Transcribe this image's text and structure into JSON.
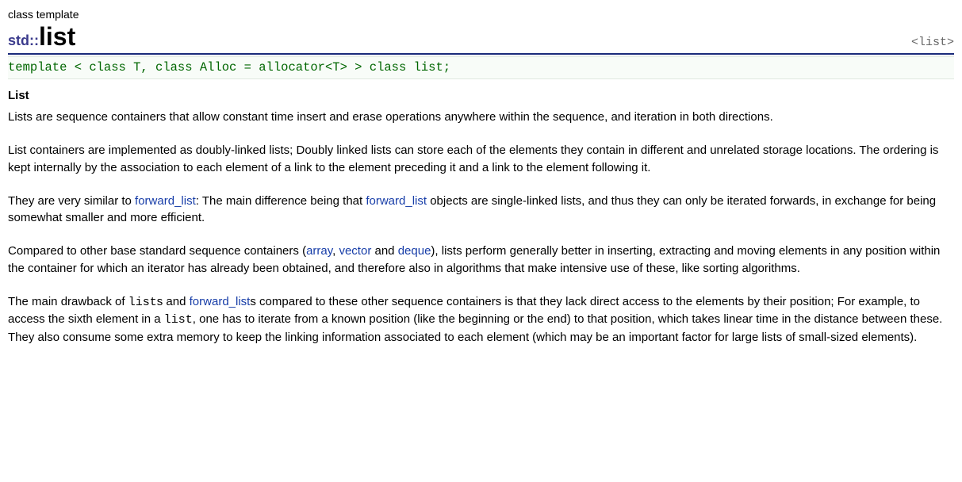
{
  "category": "class template",
  "namespace": "std::",
  "class_name": "list",
  "header_include": "<list>",
  "template_decl": "template < class T, class Alloc = allocator<T> > class list;",
  "section_title": "List",
  "paragraphs": {
    "p1": "Lists are sequence containers that allow constant time insert and erase operations anywhere within the sequence, and iteration in both directions.",
    "p2": "List containers are implemented as doubly-linked lists; Doubly linked lists can store each of the elements they contain in different and unrelated storage locations. The ordering is kept internally by the association to each element of a link to the element preceding it and a link to the element following it.",
    "p3a": "They are very similar to ",
    "p3_link1": "forward_list",
    "p3b": ": The main difference being that ",
    "p3_link2": "forward_list",
    "p3c": " objects are single-linked lists, and thus they can only be iterated forwards, in exchange for being somewhat smaller and more efficient.",
    "p4a": "Compared to other base standard sequence containers (",
    "p4_link1": "array",
    "p4b": ", ",
    "p4_link2": "vector",
    "p4c": " and ",
    "p4_link3": "deque",
    "p4d": "), lists perform generally better in inserting, extracting and moving elements in any position within the container for which an iterator has already been obtained, and therefore also in algorithms that make intensive use of these, like sorting algorithms.",
    "p5a": "The main drawback of ",
    "p5_mono1": "list",
    "p5b": "s and ",
    "p5_link1": "forward_list",
    "p5c": "s compared to these other sequence containers is that they lack direct access to the elements by their position; For example, to access the sixth element in a ",
    "p5_mono2": "list",
    "p5d": ", one has to iterate from a known position (like the beginning or the end) to that position, which takes linear time in the distance between these. They also consume some extra memory to keep the linking information associated to each element (which may be an important factor for large lists of small-sized elements)."
  }
}
